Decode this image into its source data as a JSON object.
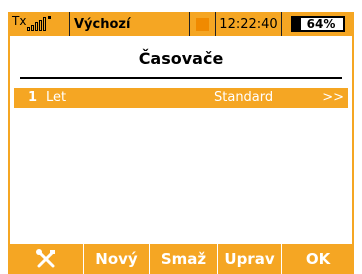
{
  "statusbar": {
    "tx_label": "Tx",
    "model_name": "Výchozí",
    "time": "12:22:40",
    "battery": "64%",
    "accent": "#f5a623",
    "indicator_color": "#f08a00"
  },
  "screen": {
    "title": "Časovače"
  },
  "timers": [
    {
      "index": "1",
      "name": "Let",
      "type": "Standard",
      "more": ">>"
    }
  ],
  "footer": {
    "tools_icon": "wrench-screwdriver-icon",
    "new_label": "Nový",
    "delete_label": "Smaž",
    "edit_label": "Uprav",
    "ok_label": "OK"
  }
}
